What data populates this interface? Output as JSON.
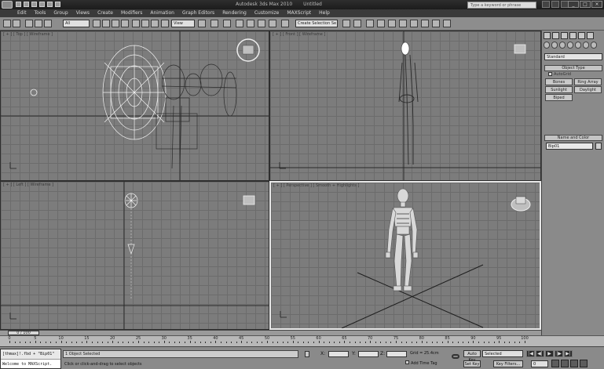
{
  "title_bar": {
    "app_title": "Autodesk 3ds Max  2010",
    "doc_title": "Untitled",
    "search_placeholder": "Type a keyword or phrase",
    "window_controls": [
      "_",
      "□",
      "×"
    ]
  },
  "menu": [
    "Edit",
    "Tools",
    "Group",
    "Views",
    "Create",
    "Modifiers",
    "Animation",
    "Graph Editors",
    "Rendering",
    "Customize",
    "MAXScript",
    "Help"
  ],
  "toolbar": {
    "selection_filter": "All",
    "reference_coord": "View",
    "named_selection": "Create Selection Se"
  },
  "viewports": {
    "top": {
      "label": "[ + ] [ Top ] [ Wireframe ]"
    },
    "front": {
      "label": "[ + ] [ Front ] [ Wireframe ]"
    },
    "left": {
      "label": "[ + ] [ Left ] [ Wireframe ]"
    },
    "perspective": {
      "label": "[ + ] [ Perspective ] [ Smooth + Highlights ]"
    }
  },
  "command_panel": {
    "category": "Standard",
    "object_type_header": "Object Type",
    "autogrid_label": "AutoGrid",
    "buttons": [
      "Bones",
      "Ring Array",
      "Sunlight",
      "Daylight",
      "Biped"
    ],
    "name_color_header": "Name and Color",
    "object_name": "Bip01"
  },
  "timeline": {
    "slider_text": "0 / 100",
    "ticks": [
      0,
      5,
      10,
      15,
      20,
      25,
      30,
      35,
      40,
      45,
      50,
      55,
      60,
      65,
      70,
      75,
      80,
      85,
      90,
      95,
      100
    ]
  },
  "status": {
    "listener_line1": "[thmax]!.fbd + \"Bip01\"",
    "listener_line2": "Welcome to MAXScript.",
    "selection_text": "1 Object Selected",
    "prompt_text": "Click or click-and-drag to select objects",
    "x_label": "X:",
    "y_label": "Y:",
    "z_label": "Z:",
    "grid_text": "Grid = 25.4cm",
    "add_time_tag": "Add Time Tag",
    "auto_key": "Auto Key",
    "set_key": "Set Key",
    "selected_value": "Selected",
    "key_filters": "Key Filters...",
    "frame_value": "0",
    "playback": [
      "|◀",
      "◀|",
      "▶",
      "|▶",
      "▶|"
    ]
  }
}
